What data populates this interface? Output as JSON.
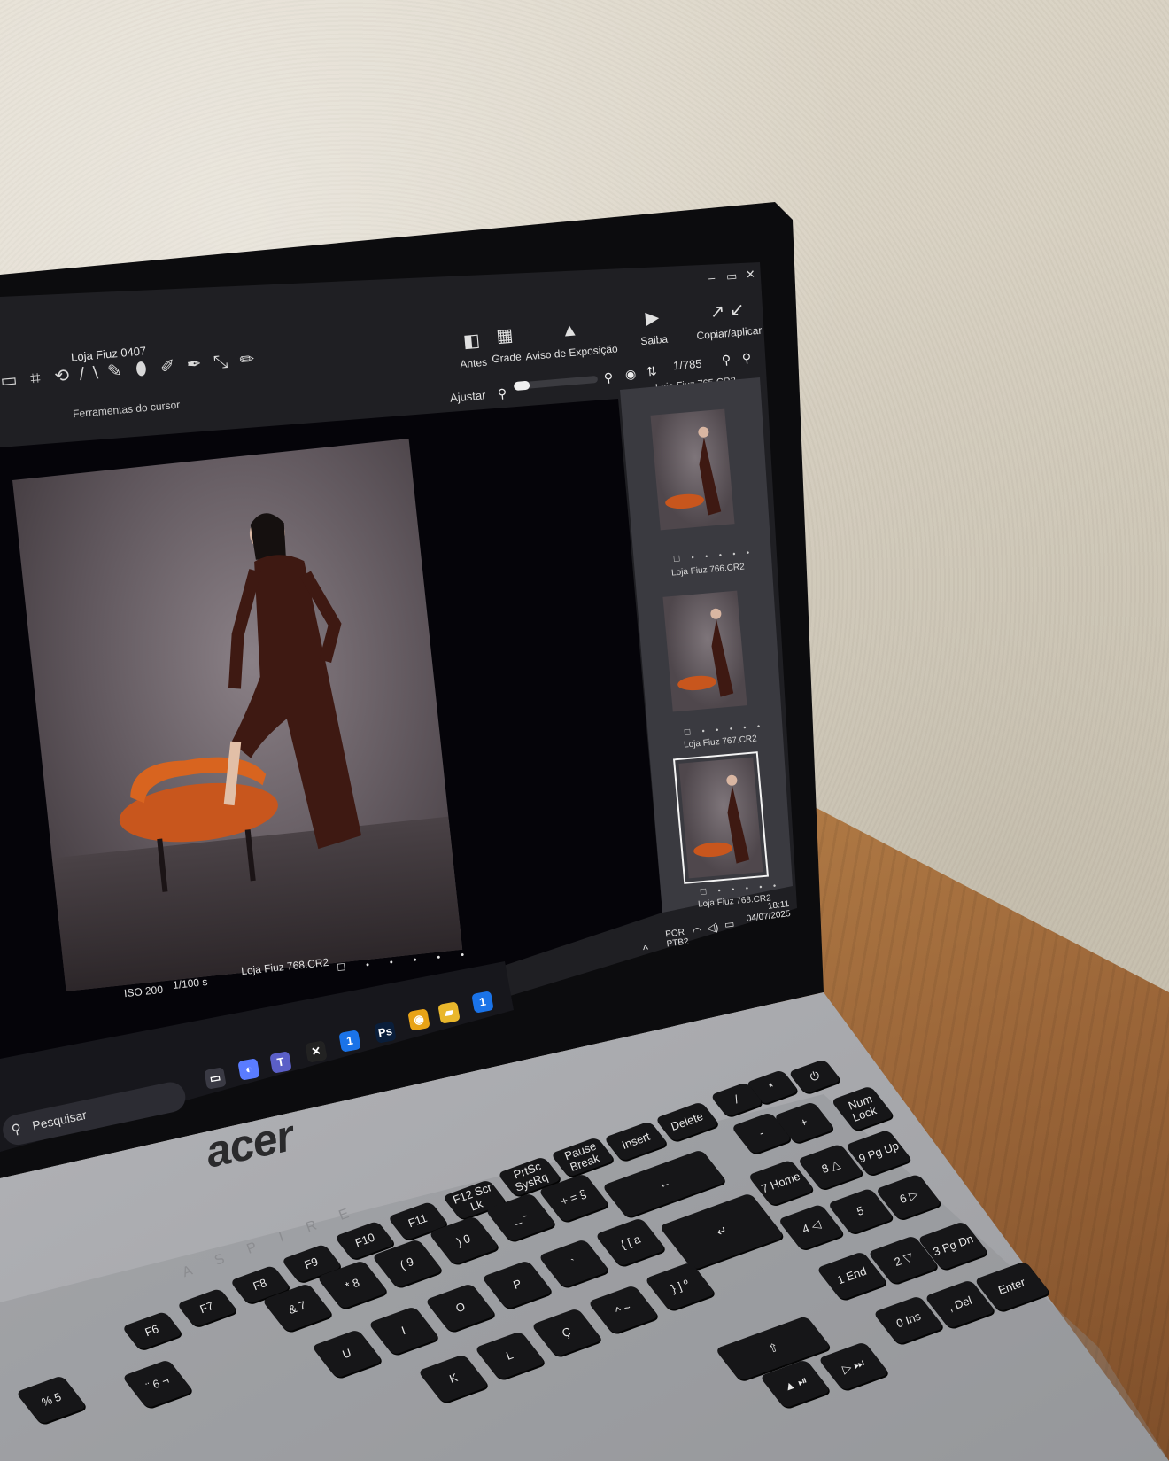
{
  "app": {
    "title": "Loja Fiuz 0407",
    "cursor_tools_label": "Ferramentas do cursor",
    "cursor_tools": [
      "▭",
      "⌗",
      "⟲",
      "/\\",
      "✎",
      "⬮",
      "✐",
      "✒",
      "⤡",
      "✏"
    ],
    "toolbar": {
      "before": "Antes",
      "grid": "Grade",
      "exposure_warning": "Aviso de Exposição",
      "learn": "Saiba",
      "copy_apply": "Copiar/aplicar"
    },
    "zoom_label": "Ajustar",
    "counter": "1/785",
    "current_filename_top": "Loja Fiuz 765.CR2",
    "viewer": {
      "iso": "ISO 200",
      "shutter": "1/100 s",
      "filename": "Loja Fiuz 768.CR2",
      "rating": "☐ • • • • •"
    },
    "thumbnails": [
      {
        "name": "Loja Fiuz 766.CR2",
        "rating": "☐ • • • • •"
      },
      {
        "name": "Loja Fiuz 767.CR2",
        "rating": "☐ • • • • •"
      },
      {
        "name": "Loja Fiuz 768.CR2",
        "rating": "☐ • • • • •"
      }
    ]
  },
  "system": {
    "lang1": "POR",
    "lang2": "PTB2",
    "time": "18:11",
    "date": "04/07/2025",
    "search_placeholder": "Pesquisar"
  },
  "taskbar_icons": [
    {
      "name": "copilot",
      "glyph": "◐",
      "color": "#5a7cff"
    },
    {
      "name": "teams",
      "glyph": "T",
      "color": "#5b5fc7"
    },
    {
      "name": "capcut",
      "glyph": "✕",
      "color": "#222"
    },
    {
      "name": "onepassword",
      "glyph": "1",
      "color": "#1a73e8"
    },
    {
      "name": "photoshop",
      "glyph": "Ps",
      "color": "#0a1e3a"
    },
    {
      "name": "chrome",
      "glyph": "◉",
      "color": "#e8a317"
    },
    {
      "name": "file-explorer",
      "glyph": "▰",
      "color": "#e9b72c"
    },
    {
      "name": "onepassword-active",
      "glyph": "1",
      "color": "#1a73e8"
    }
  ],
  "laptop": {
    "brand": "acer",
    "model": "ASPIRE"
  },
  "keys": [
    {
      "label": "⏻",
      "name": "power"
    },
    {
      "label": "*",
      "name": "numpad-multiply"
    },
    {
      "label": "Num Lock",
      "name": "num-lock"
    },
    {
      "label": "/",
      "name": "numpad-divide"
    },
    {
      "label": "Delete",
      "name": "delete"
    },
    {
      "label": "Insert",
      "name": "insert"
    },
    {
      "label": "Pause Break",
      "name": "pause-break"
    },
    {
      "label": "PrtSc SysRq",
      "name": "prtsc"
    },
    {
      "label": "F12 Scr Lk",
      "name": "f12"
    },
    {
      "label": "F11",
      "name": "f11"
    },
    {
      "label": "F10",
      "name": "f10"
    },
    {
      "label": "F9",
      "name": "f9"
    },
    {
      "label": "F8",
      "name": "f8"
    },
    {
      "label": "F7",
      "name": "f7"
    },
    {
      "label": "F6",
      "name": "f6"
    },
    {
      "label": "-",
      "name": "numpad-minus"
    },
    {
      "label": "+",
      "name": "numpad-plus"
    },
    {
      "label": "9 Pg Up",
      "name": "numpad-9"
    },
    {
      "label": "8 △",
      "name": "numpad-8"
    },
    {
      "label": "7 Home",
      "name": "numpad-7"
    },
    {
      "label": "←",
      "name": "backspace"
    },
    {
      "label": "+ =  §",
      "name": "equals"
    },
    {
      "label": "_ -",
      "name": "minus"
    },
    {
      "label": ") 0",
      "name": "digit-0"
    },
    {
      "label": "( 9",
      "name": "digit-9"
    },
    {
      "label": "* 8",
      "name": "digit-8"
    },
    {
      "label": "& 7",
      "name": "digit-7"
    },
    {
      "label": "6 ▷",
      "name": "numpad-6"
    },
    {
      "label": "5",
      "name": "numpad-5"
    },
    {
      "label": "4 ◁",
      "name": "numpad-4"
    },
    {
      "label": "↵",
      "name": "enter-main"
    },
    {
      "label": "{ [  a",
      "name": "bracket-open"
    },
    {
      "label": "`",
      "name": "acute"
    },
    {
      "label": "P",
      "name": "key-p"
    },
    {
      "label": "O",
      "name": "key-o"
    },
    {
      "label": "I",
      "name": "key-i"
    },
    {
      "label": "U",
      "name": "key-u"
    },
    {
      "label": "3 Pg Dn",
      "name": "numpad-3"
    },
    {
      "label": "2 ▽",
      "name": "numpad-2"
    },
    {
      "label": "1 End",
      "name": "numpad-1"
    },
    {
      "label": "} ]  º",
      "name": "bracket-close"
    },
    {
      "label": "^ ~",
      "name": "tilde"
    },
    {
      "label": "Ç",
      "name": "key-cedilla"
    },
    {
      "label": "L",
      "name": "key-l"
    },
    {
      "label": "K",
      "name": "key-k"
    },
    {
      "label": "Enter",
      "name": "numpad-enter"
    },
    {
      "label": ", Del",
      "name": "numpad-del"
    },
    {
      "label": "0 Ins",
      "name": "numpad-0"
    },
    {
      "label": "⇧",
      "name": "shift-right"
    },
    {
      "label": "▷ ⏭",
      "name": "media-next"
    },
    {
      "label": "▲ ⏯",
      "name": "media-play"
    },
    {
      "label": "% 5",
      "name": "digit-5"
    },
    {
      "label": "¨ 6 ¬",
      "name": "digit-6"
    }
  ]
}
